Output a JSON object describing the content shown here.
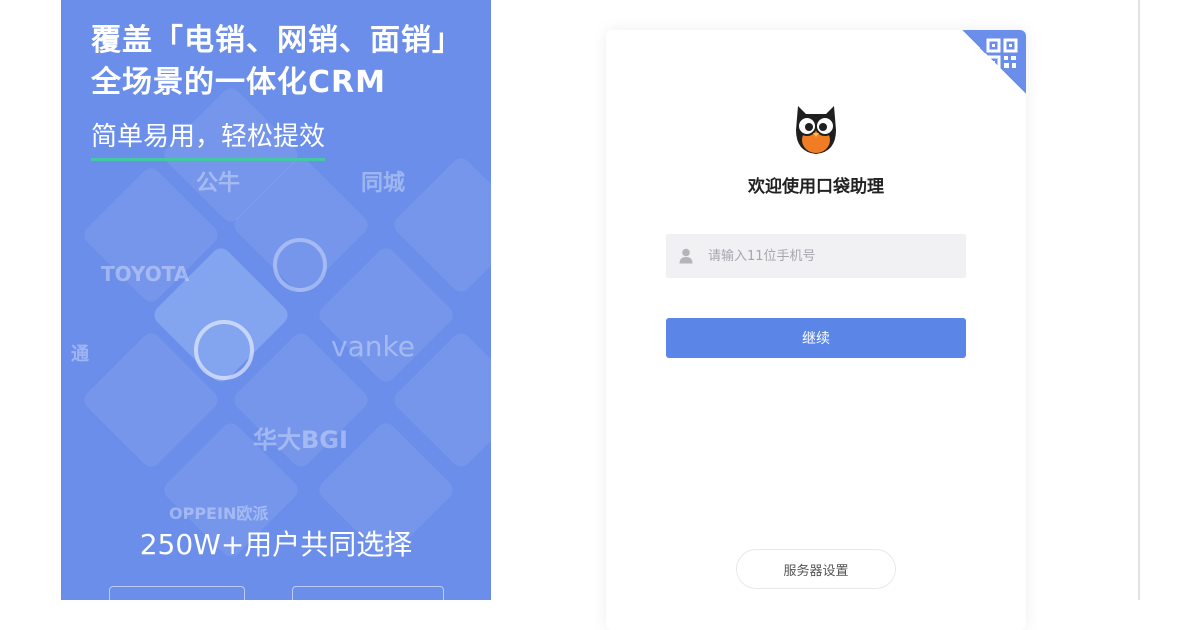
{
  "promo": {
    "headline_line1": "覆盖「电销、网销、面销」",
    "headline_line2": "全场景的一体化CRM",
    "subheadline": "简单易用，轻松提效",
    "brands": {
      "toyota": "TOYOTA",
      "vanke": "vanke",
      "bgi": "华大BGI",
      "oppein": "OPPEIN欧派",
      "gongniu": "公牛",
      "tongcheng": "同城",
      "tong": "通"
    },
    "users_text": "250W+用户共同选择",
    "accent_color": "#44c8a4",
    "background_color": "#6a8eea"
  },
  "login": {
    "qr_icon": "qr-code-icon",
    "logo_icon": "owl-logo-icon",
    "welcome": "欢迎使用口袋助理",
    "phone_placeholder": "请输入11位手机号",
    "phone_value": "",
    "continue_label": "继续",
    "server_settings_label": "服务器设置",
    "button_color": "#5b86e8"
  }
}
